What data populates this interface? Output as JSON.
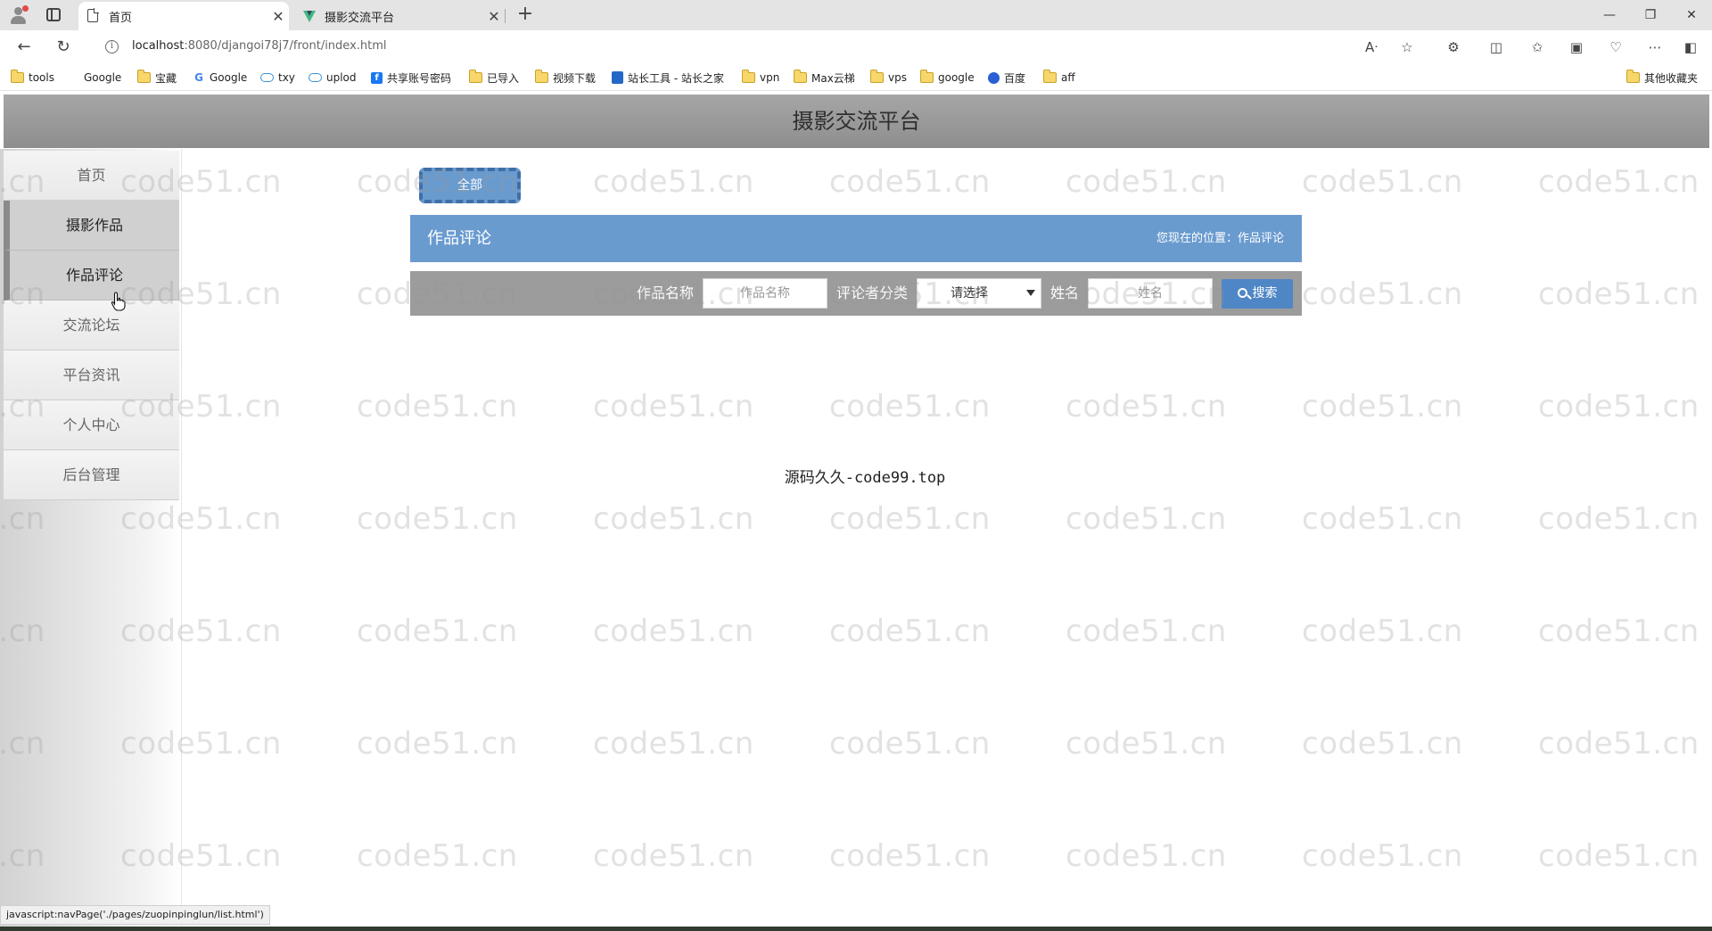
{
  "browser": {
    "tabs": [
      {
        "title": "首页",
        "icon": "page-icon",
        "active": true
      },
      {
        "title": "摄影交流平台",
        "icon": "vue-icon",
        "active": false
      }
    ],
    "url_host": "localhost",
    "url_path": ":8080/djangoi78j7/front/index.html",
    "bookmarks": [
      "tools",
      "Google",
      "宝藏",
      "Google",
      "txy",
      "uplod",
      "共享账号密码",
      "已导入",
      "视频下载",
      "站长工具 - 站长之家",
      "vpn",
      "Max云梯",
      "vps",
      "google",
      "百度",
      "aff"
    ],
    "other_bookmarks": "其他收藏夹",
    "status_url": "javascript:navPage('./pages/zuopinpinglun/list.html')"
  },
  "site": {
    "title": "摄影交流平台",
    "watermark": "code51.cn"
  },
  "sidebar": {
    "items": [
      {
        "label": "首页"
      },
      {
        "label": "摄影作品"
      },
      {
        "label": "作品评论"
      },
      {
        "label": "交流论坛"
      },
      {
        "label": "平台资讯"
      },
      {
        "label": "个人中心"
      },
      {
        "label": "后台管理"
      }
    ]
  },
  "main": {
    "filter_button": "全部",
    "section_title": "作品评论",
    "breadcrumb": "您现在的位置：作品评论",
    "search": {
      "work_name_label": "作品名称",
      "work_name_placeholder": "作品名称",
      "category_label": "评论者分类",
      "category_value": "请选择",
      "name_label": "姓名",
      "name_placeholder": "姓名",
      "search_button": "搜索"
    },
    "footer": "源码久久-code99.top"
  },
  "colors": {
    "accent": "#6a9bcf",
    "header": "#9a9a9a",
    "search_button": "#4f86c6"
  }
}
